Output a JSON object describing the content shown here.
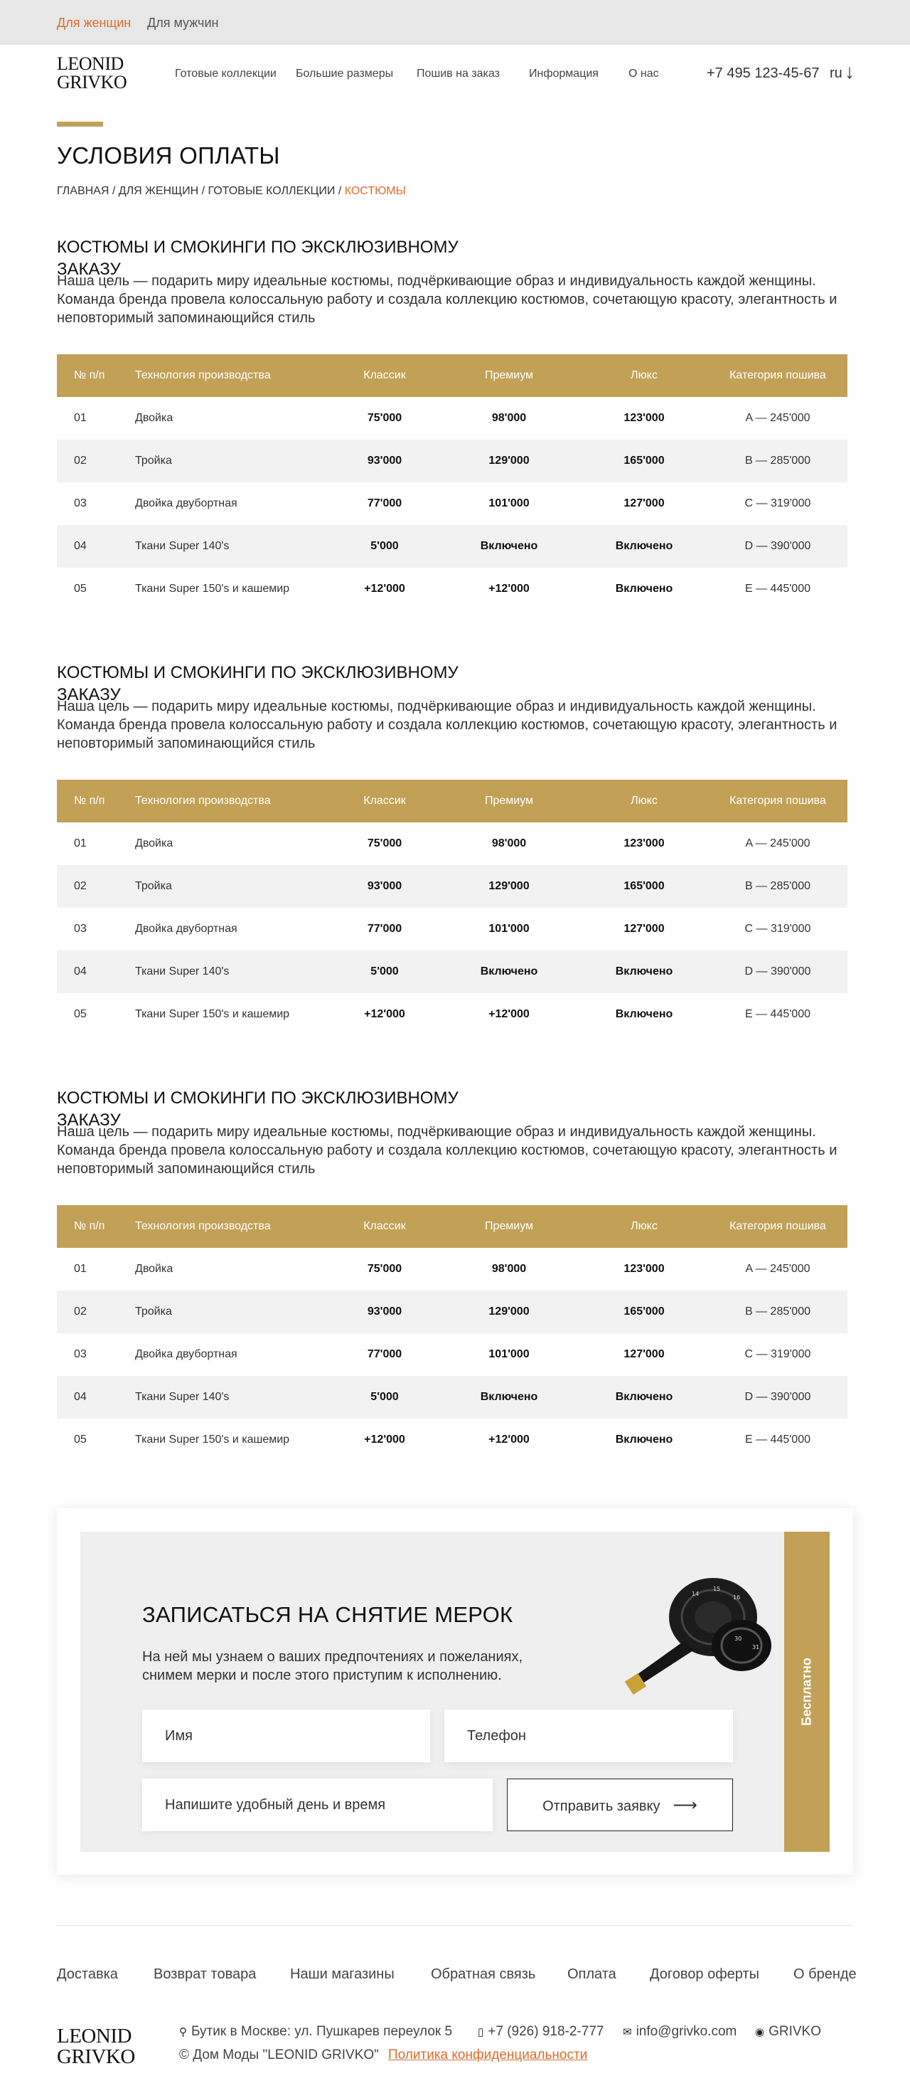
{
  "topbar": {
    "women": "Для женщин",
    "men": "Для мужчин"
  },
  "header": {
    "logo_line1": "LEONID",
    "logo_line2": "GRIVKO",
    "nav": [
      "Готовые коллекции",
      "Большие размеры",
      "Пошив на заказ",
      "Информация",
      "О нас"
    ],
    "phone": "+7 495 123-45-67",
    "lang": "ru"
  },
  "page": {
    "title": "УСЛОВИЯ ОПЛАТЫ",
    "breadcrumb": [
      "ГЛАВНАЯ",
      "ДЛЯ ЖЕНЩИН",
      "ГОТОВЫЕ КОЛЛЕКЦИИ"
    ],
    "breadcrumb_active": "КОСТЮМЫ",
    "breadcrumb_sep": " / "
  },
  "sections": [
    {
      "title": "КОСТЮМЫ И СМОКИНГИ ПО ЭКСКЛЮЗИВНОМУ ЗАКАЗУ",
      "text": "Наша цель — подарить миру идеальные костюмы, подчёркивающие образ и индивидуальность каждой женщины. Команда бренда провела колоссальную работу и создала коллекцию костюмов, сочетающую красоту, элегантность и неповторимый запоминающийся стиль"
    },
    {
      "title": "КОСТЮМЫ И СМОКИНГИ ПО ЭКСКЛЮЗИВНОМУ ЗАКАЗУ",
      "text": "Наша цель — подарить миру идеальные костюмы, подчёркивающие образ и индивидуальность каждой женщины. Команда бренда провела колоссальную работу и создала коллекцию костюмов, сочетающую красоту, элегантность и неповторимый запоминающийся стиль"
    },
    {
      "title": "КОСТЮМЫ И СМОКИНГИ ПО ЭКСКЛЮЗИВНОМУ ЗАКАЗУ",
      "text": "Наша цель — подарить миру идеальные костюмы, подчёркивающие образ и индивидуальность каждой женщины. Команда бренда провела колоссальную работу и создала коллекцию костюмов, сочетающую красоту, элегантность и неповторимый запоминающийся стиль"
    }
  ],
  "table": {
    "headers": [
      "№ п/п",
      "Технология производства",
      "Классик",
      "Премиум",
      "Люкс",
      "Категория пошива"
    ],
    "rows": [
      [
        "01",
        "Двойка",
        "75'000",
        "98'000",
        "123'000",
        "A — 245'000"
      ],
      [
        "02",
        "Тройка",
        "93'000",
        "129'000",
        "165'000",
        "B — 285'000"
      ],
      [
        "03",
        "Двойка двубортная",
        "77'000",
        "101'000",
        "127'000",
        "C — 319'000"
      ],
      [
        "04",
        "Ткани Super 140's",
        "5'000",
        "Включено",
        "Включено",
        "D — 390'000"
      ],
      [
        "05",
        "Ткани Super 150's и кашемир",
        "+12'000",
        "+12'000",
        "Включено",
        "E — 445'000"
      ]
    ]
  },
  "form": {
    "title": "ЗАПИСАТЬСЯ НА СНЯТИЕ МЕРОК",
    "description": "На ней мы узнаем о ваших предпочтениях и пожеланиях, снимем мерки и после этого приступим к исполнению.",
    "name_placeholder": "Имя",
    "phone_placeholder": "Телефон",
    "datetime_placeholder": "Напишите удобный день и время",
    "submit_label": "Отправить заявку",
    "submit_arrow": "⟶",
    "side_label": "Бесплатно"
  },
  "footer": {
    "nav": [
      "Доставка",
      "Возврат товара",
      "Наши магазины",
      "Обратная связь",
      "Оплата",
      "Договор оферты",
      "О бренде"
    ],
    "logo_line1": "LEONID",
    "logo_line2": "GRIVKO",
    "address": "Бутик в Москве: ул. Пушкарев переулок 5",
    "phone": "+7 (926) 918-2-777",
    "email": "info@grivko.com",
    "social": "GRIVKO",
    "copyright": "© Дом Моды \"LEONID GRIVKO\"",
    "policy": "Политика конфиденциальности"
  },
  "colors": {
    "accent": "#c2a157",
    "link": "#e06a2b"
  }
}
